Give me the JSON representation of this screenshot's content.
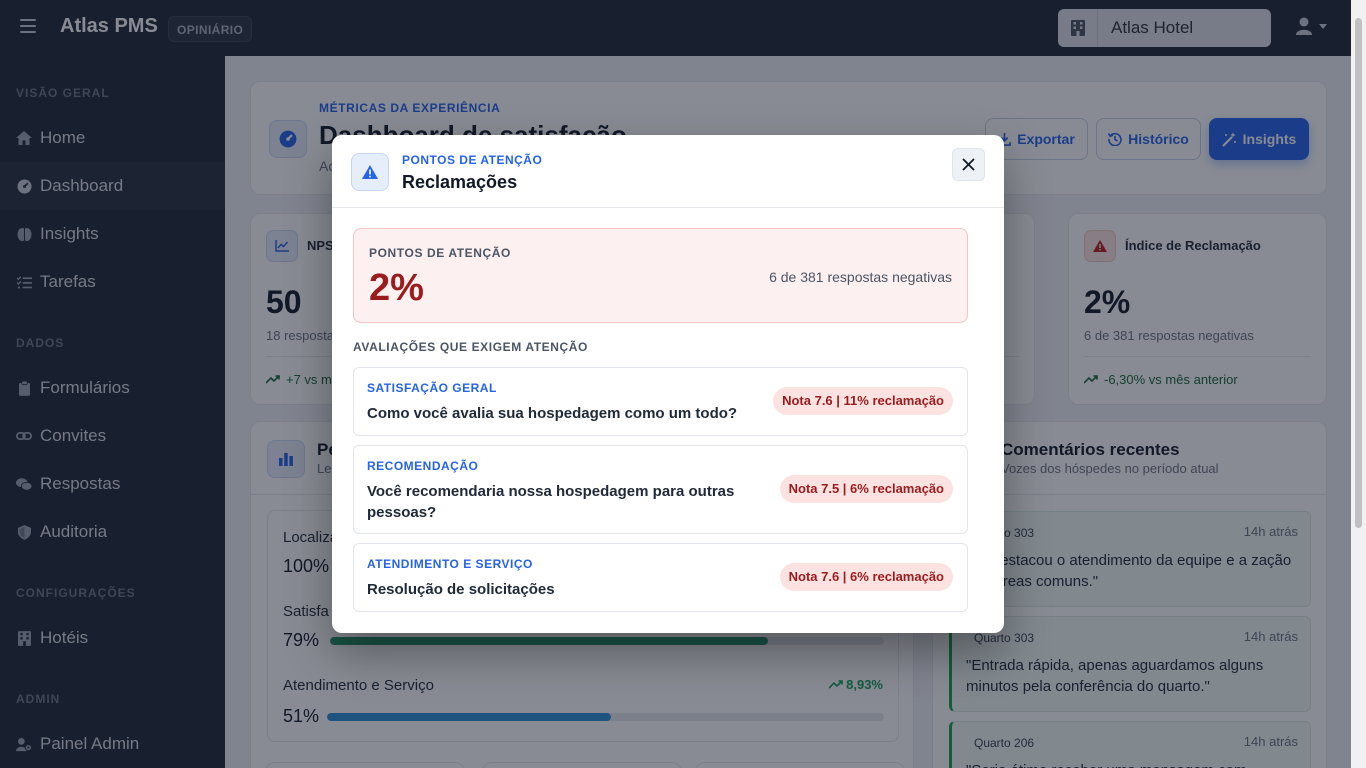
{
  "topbar": {
    "brand": "Atlas PMS",
    "badge": "OPINIÁRIO",
    "hotel": "Atlas Hotel"
  },
  "sidebar": {
    "sections": [
      {
        "title": "VISÃO GERAL"
      },
      {
        "title": "DADOS"
      },
      {
        "title": "CONFIGURAÇÕES"
      },
      {
        "title": "ADMIN"
      }
    ],
    "items": [
      {
        "label": "Home",
        "icon": "home-icon"
      },
      {
        "label": "Dashboard",
        "icon": "gauge-icon",
        "active": true
      },
      {
        "label": "Insights",
        "icon": "brain-icon"
      },
      {
        "label": "Tarefas",
        "icon": "tasks-icon"
      },
      {
        "label": "Formulários",
        "icon": "clipboard-icon"
      },
      {
        "label": "Convites",
        "icon": "link-icon"
      },
      {
        "label": "Respostas",
        "icon": "comments-icon"
      },
      {
        "label": "Auditoria",
        "icon": "shield-icon"
      },
      {
        "label": "Hotéis",
        "icon": "building-icon"
      },
      {
        "label": "Painel Admin",
        "icon": "user-gear-icon"
      }
    ]
  },
  "header": {
    "eyebrow": "MÉTRICAS DA EXPERIÊNCIA",
    "title": "Dashboard de satisfação",
    "subtitle": "Ac",
    "buttons": {
      "export": "Exportar",
      "history": "Histórico",
      "insights": "Insights"
    }
  },
  "kpis": {
    "nps": {
      "label": "NPS",
      "value": "50",
      "sub": "18 respostas",
      "trend": "+7 vs m"
    },
    "complaint": {
      "label": "Índice de Reclamação",
      "value": "2%",
      "sub": "6 de 381 respostas negativas",
      "trend": "-6,30% vs mês anterior"
    }
  },
  "performance": {
    "title": "Pe",
    "subtitle": "Le",
    "metrics": [
      {
        "label": "Localiza",
        "pct": "100%",
        "value": 100,
        "trend": ""
      },
      {
        "label": "Satisfa",
        "pct": "79%",
        "value": 79,
        "trend": ""
      },
      {
        "label": "Atendimento e Serviço",
        "pct": "51%",
        "value": 51,
        "trend": "8,93%"
      }
    ],
    "colors": {
      "green": "#22956a",
      "blue": "#2a8fd6"
    }
  },
  "comments": {
    "title": "Comentários recentes",
    "subtitle": "Vozes dos hóspedes no período atual",
    "items": [
      {
        "room": "Quarto 303",
        "time": "14h atrás",
        "text": "rdo destacou o atendimento da equipe e a zação das áreas comuns.\""
      },
      {
        "room": "Quarto 303",
        "time": "14h atrás",
        "text": "\"Entrada rápida, apenas aguardamos alguns minutos pela conferência do quarto.\""
      },
      {
        "room": "Quarto 206",
        "time": "14h atrás",
        "text": "\"Seria ótimo receber uma mensagem com"
      }
    ]
  },
  "modal": {
    "eyebrow": "PONTOS DE ATENÇÃO",
    "title": "Reclamações",
    "alert": {
      "label": "PONTOS DE ATENÇÃO",
      "value": "2%",
      "desc": "6 de 381 respostas negativas"
    },
    "section": "AVALIAÇÕES QUE EXIGEM ATENÇÃO",
    "questions": [
      {
        "category": "SATISFAÇÃO GERAL",
        "text": "Como você avalia sua hospedagem como um todo?",
        "badge": "Nota 7.6 | 11% reclamação"
      },
      {
        "category": "RECOMENDAÇÃO",
        "text": "Você recomendaria nossa hospedagem para outras pessoas?",
        "badge": "Nota 7.5 | 6% reclamação"
      },
      {
        "category": "ATENDIMENTO E SERVIÇO",
        "text": "Resolução de solicitações",
        "badge": "Nota 7.6 | 6% reclamação"
      }
    ]
  }
}
